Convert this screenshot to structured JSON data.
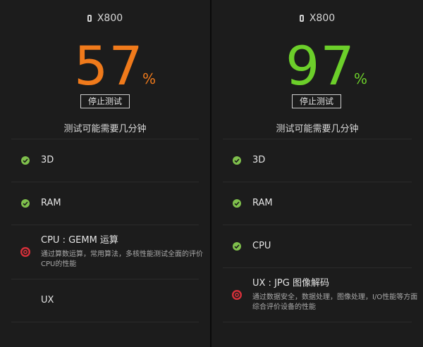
{
  "panels": [
    {
      "device": "X800",
      "score": "57",
      "percent_sign": "%",
      "progress_percent": 57,
      "score_color": "#f07a1b",
      "stop_button": "停止测试",
      "note": "测试可能需要几分钟",
      "items": [
        {
          "label": "3D",
          "status": "done"
        },
        {
          "label": "RAM",
          "status": "done"
        },
        {
          "label": "CPU : GEMM 运算",
          "status": "running",
          "desc": "通过算数运算，常用算法，多核性能测试全面的评价CPU的性能"
        },
        {
          "label": "UX",
          "status": "pending"
        }
      ]
    },
    {
      "device": "X800",
      "score": "97",
      "percent_sign": "%",
      "progress_percent": 97,
      "score_color": "#6ccf2a",
      "stop_button": "停止测试",
      "note": "测试可能需要几分钟",
      "items": [
        {
          "label": "3D",
          "status": "done"
        },
        {
          "label": "RAM",
          "status": "done"
        },
        {
          "label": "CPU",
          "status": "done"
        },
        {
          "label": "UX : JPG 图像解码",
          "status": "running",
          "desc": "通过数据安全，数据处理，图像处理，I/O性能等方面综合评价设备的性能"
        }
      ]
    }
  ],
  "icons": {
    "done": "check-circle-icon",
    "running": "target-icon",
    "device": "phone-icon"
  }
}
